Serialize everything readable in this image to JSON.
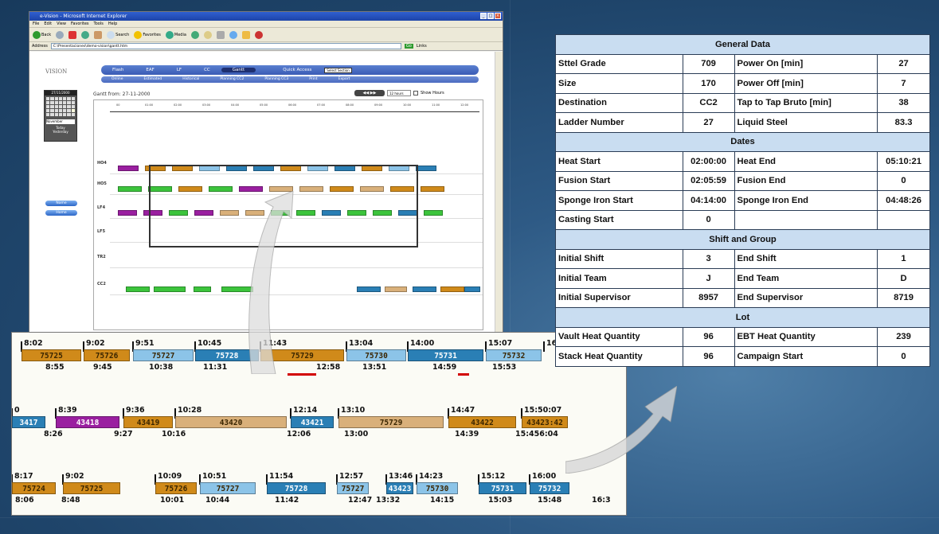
{
  "browser": {
    "title": "e-Vision - Microsoft Internet Explorer",
    "menu": [
      "File",
      "Edit",
      "View",
      "Favorites",
      "Tools",
      "Help"
    ],
    "toolbar": [
      "Back",
      "Search",
      "Favorites",
      "Media"
    ],
    "address_label": "Address",
    "address": "C:\\Presentaciones\\demo-vision\\gantt.htm",
    "go": "Go",
    "links": "Links"
  },
  "app": {
    "logo": "VISION",
    "nav_tabs": [
      "Flash",
      "EAF",
      "LF",
      "CC",
      "Gantt"
    ],
    "active_tab": "Gantt",
    "quick_access_label": "Quick Access",
    "quick_access_value": "Select Section",
    "sub_tabs": [
      "Online",
      "Estimated",
      "Historical",
      "Planning CC2",
      "Planning CC3",
      "Print",
      "Export"
    ],
    "calendar_header": "27/11/2000",
    "calendar_month": "November",
    "calendar_footer": [
      "Today",
      "Yesterday"
    ],
    "side_buttons": [
      "Name",
      "Home"
    ],
    "gantt_title": "Gantt from: 27-11-2000",
    "hours_select": "12 hours",
    "show_hours": "Show Hours",
    "rows": [
      "HO4",
      "HO5",
      "LF4",
      "LF5",
      "TR2",
      "CC2"
    ],
    "ticks": [
      "00",
      "01:00",
      "02:00",
      "03:00",
      "04:00",
      "05:00",
      "06:00",
      "07:00",
      "08:00",
      "09:00",
      "10:00",
      "11:00",
      "12:00"
    ]
  },
  "zoom": {
    "row1": {
      "labels": [
        {
          "t": "8:02",
          "c": "75725"
        },
        {
          "t": "9:02",
          "c": "75726"
        },
        {
          "t": "9:51",
          "c": "75727"
        },
        {
          "t": "10:45",
          "c": "75728"
        },
        {
          "t": "11:43",
          "c": "75729"
        },
        {
          "t": "13:04",
          "c": "75730"
        },
        {
          "t": "14:00",
          "c": "75731"
        },
        {
          "t": "15:07",
          "c": "75732"
        },
        {
          "t": "16",
          "c": ""
        }
      ],
      "ends": [
        "8:55",
        "9:45",
        "10:38",
        "11:31",
        "12:58",
        "13:51",
        "14:59",
        "15:53"
      ]
    },
    "row2": {
      "labels": [
        {
          "t": "0",
          "c": "3417"
        },
        {
          "t": "8:39",
          "c": "43418"
        },
        {
          "t": "9:36",
          "c": "43419"
        },
        {
          "t": "10:28",
          "c": "43420"
        },
        {
          "t": "12:14",
          "c": "43421"
        },
        {
          "t": "13:10",
          "c": "75729"
        },
        {
          "t": "14:47",
          "c": "43422"
        },
        {
          "t": "15:50:07",
          "c": "43423:42"
        }
      ],
      "ends": [
        "8:26",
        "9:27",
        "10:16",
        "12:06",
        "13:00",
        "14:39",
        "15:456:04"
      ]
    },
    "row3": {
      "labels": [
        {
          "t": "8:17",
          "c": "75724"
        },
        {
          "t": "9:02",
          "c": "75725"
        },
        {
          "t": "10:09",
          "c": "75726"
        },
        {
          "t": "10:51",
          "c": "75727"
        },
        {
          "t": "11:54",
          "c": "75728"
        },
        {
          "t": "12:57",
          "c": "75727"
        },
        {
          "t": "13:46",
          "c": "43423"
        },
        {
          "t": "14:23",
          "c": "75730"
        },
        {
          "t": "15:12",
          "c": "75731"
        },
        {
          "t": "16:00",
          "c": "75732"
        }
      ],
      "ends": [
        "8:06",
        "8:48",
        "10:01",
        "10:44",
        "11:42",
        "12:47",
        "13:32",
        "14:15",
        "15:03",
        "15:48",
        "16:3"
      ]
    }
  },
  "table": {
    "general": {
      "title": "General Data",
      "rows": [
        [
          "Sttel Grade",
          "709",
          "Power On [min]",
          "27"
        ],
        [
          "Size",
          "170",
          "Power Off [min]",
          "7"
        ],
        [
          "Destination",
          "CC2",
          "Tap to Tap Bruto [min]",
          "38"
        ],
        [
          "Ladder Number",
          "27",
          "Liquid Steel",
          "83.3"
        ]
      ]
    },
    "dates": {
      "title": "Dates",
      "rows": [
        [
          "Heat Start",
          "02:00:00",
          "Heat End",
          "05:10:21"
        ],
        [
          "Fusion Start",
          "02:05:59",
          "Fusion End",
          "0"
        ],
        [
          "Sponge Iron Start",
          "04:14:00",
          "Sponge Iron End",
          "04:48:26"
        ],
        [
          "Casting Start",
          "0",
          "",
          ""
        ]
      ]
    },
    "shift": {
      "title": "Shift and Group",
      "rows": [
        [
          "Initial Shift",
          "3",
          "End Shift",
          "1"
        ],
        [
          "Initial Team",
          "J",
          "End Team",
          "D"
        ],
        [
          "Initial Supervisor",
          "8957",
          "End Supervisor",
          "8719"
        ]
      ]
    },
    "lot": {
      "title": "Lot",
      "rows": [
        [
          "Vault Heat Quantity",
          "96",
          "EBT Heat Quantity",
          "239"
        ],
        [
          "Stack Heat Quantity",
          "96",
          "Campaign Start",
          "0"
        ]
      ]
    }
  },
  "colors": {
    "orange": "#d08a1a",
    "tan": "#d9b07a",
    "lightblue": "#8cc4e8",
    "blue": "#2a7fb5",
    "purple": "#9a1fa0",
    "green": "#3cc43c",
    "section": "#c9ddf1"
  }
}
